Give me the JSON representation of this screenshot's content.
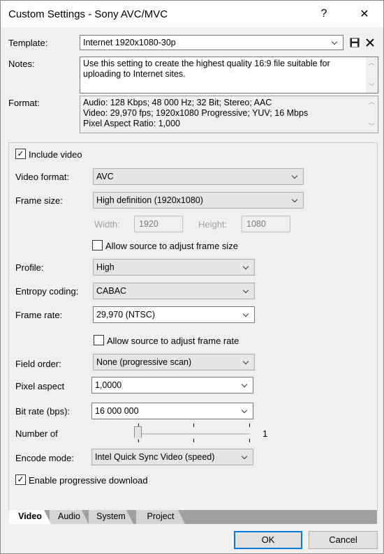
{
  "window": {
    "title": "Custom Settings - Sony AVC/MVC",
    "help": "?",
    "close": "✕"
  },
  "template": {
    "label": "Template:",
    "value": "Internet 1920x1080-30p"
  },
  "notes": {
    "label": "Notes:",
    "line1": "Use this setting to create the highest quality 16:9 file suitable for",
    "line2": "uploading to Internet sites."
  },
  "format": {
    "label": "Format:",
    "line1": "Audio: 128 Kbps; 48 000 Hz; 32 Bit; Stereo; AAC",
    "line2": "Video: 29,970 fps; 1920x1080 Progressive; YUV; 16 Mbps",
    "line3": "Pixel Aspect Ratio: 1,000"
  },
  "video": {
    "include_video": "Include video",
    "video_format_label": "Video format:",
    "video_format": "AVC",
    "frame_size_label": "Frame size:",
    "frame_size": "High definition (1920x1080)",
    "width_label": "Width:",
    "width": "1920",
    "height_label": "Height:",
    "height": "1080",
    "allow_frame_size": "Allow source to adjust frame size",
    "profile_label": "Profile:",
    "profile": "High",
    "entropy_label": "Entropy coding:",
    "entropy": "CABAC",
    "frame_rate_label": "Frame rate:",
    "frame_rate": "29,970 (NTSC)",
    "allow_frame_rate": "Allow source to adjust frame rate",
    "field_order_label": "Field order:",
    "field_order": "None (progressive scan)",
    "pixel_aspect_label": "Pixel aspect",
    "pixel_aspect": "1,0000",
    "bit_rate_label": "Bit rate (bps):",
    "bit_rate": "16 000 000",
    "number_of_label": "Number of",
    "number_of_value": "1",
    "encode_mode_label": "Encode mode:",
    "encode_mode": "Intel Quick Sync Video (speed)",
    "enable_progressive": "Enable progressive download"
  },
  "tabs": [
    "Video",
    "Audio",
    "System",
    "Project"
  ],
  "buttons": {
    "ok": "OK",
    "cancel": "Cancel"
  },
  "colors": {
    "accent": "#0078d7"
  }
}
